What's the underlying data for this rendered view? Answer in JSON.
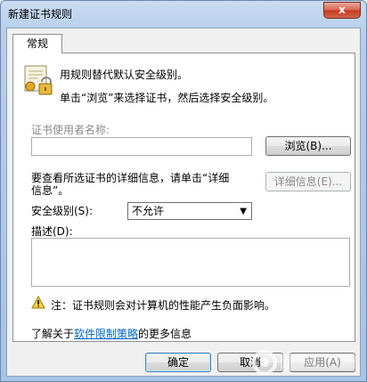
{
  "window": {
    "title": "新建证书规则",
    "close_glyph": "x"
  },
  "tabs": [
    {
      "label": "常规"
    }
  ],
  "intro": {
    "line1": "用规则替代默认安全级别。",
    "line2": "单击“浏览”来选择证书，然后选择安全级别。"
  },
  "cert_field": {
    "label": "证书使用者名称:",
    "value": "",
    "browse_button": "浏览(B)..."
  },
  "details": {
    "text_line1": "要查看所选证书的详细信息，请单击“详细",
    "text_line2": "信息”。",
    "button": "详细信息(E)..."
  },
  "security_level": {
    "label": "安全级别(S):",
    "selected": "不允许"
  },
  "description": {
    "label": "描述(D):",
    "value": ""
  },
  "note": {
    "text": "注：证书规则会对计算机的性能产生负面影响。"
  },
  "more_info": {
    "prefix": "了解关于",
    "link": "软件限制策略",
    "suffix": "的更多信息"
  },
  "footer": {
    "ok_button": "确定",
    "cancel_button": "取消",
    "apply_button": "应用(A)"
  },
  "colors": {
    "link": "#0066cc",
    "disabled_text": "#8b8b8b",
    "titlebar": "#b5cdea",
    "close_button": "#c2391f"
  },
  "icons": [
    "certificate-lock-icon",
    "warning-icon",
    "chevron-down-icon",
    "close-icon"
  ]
}
